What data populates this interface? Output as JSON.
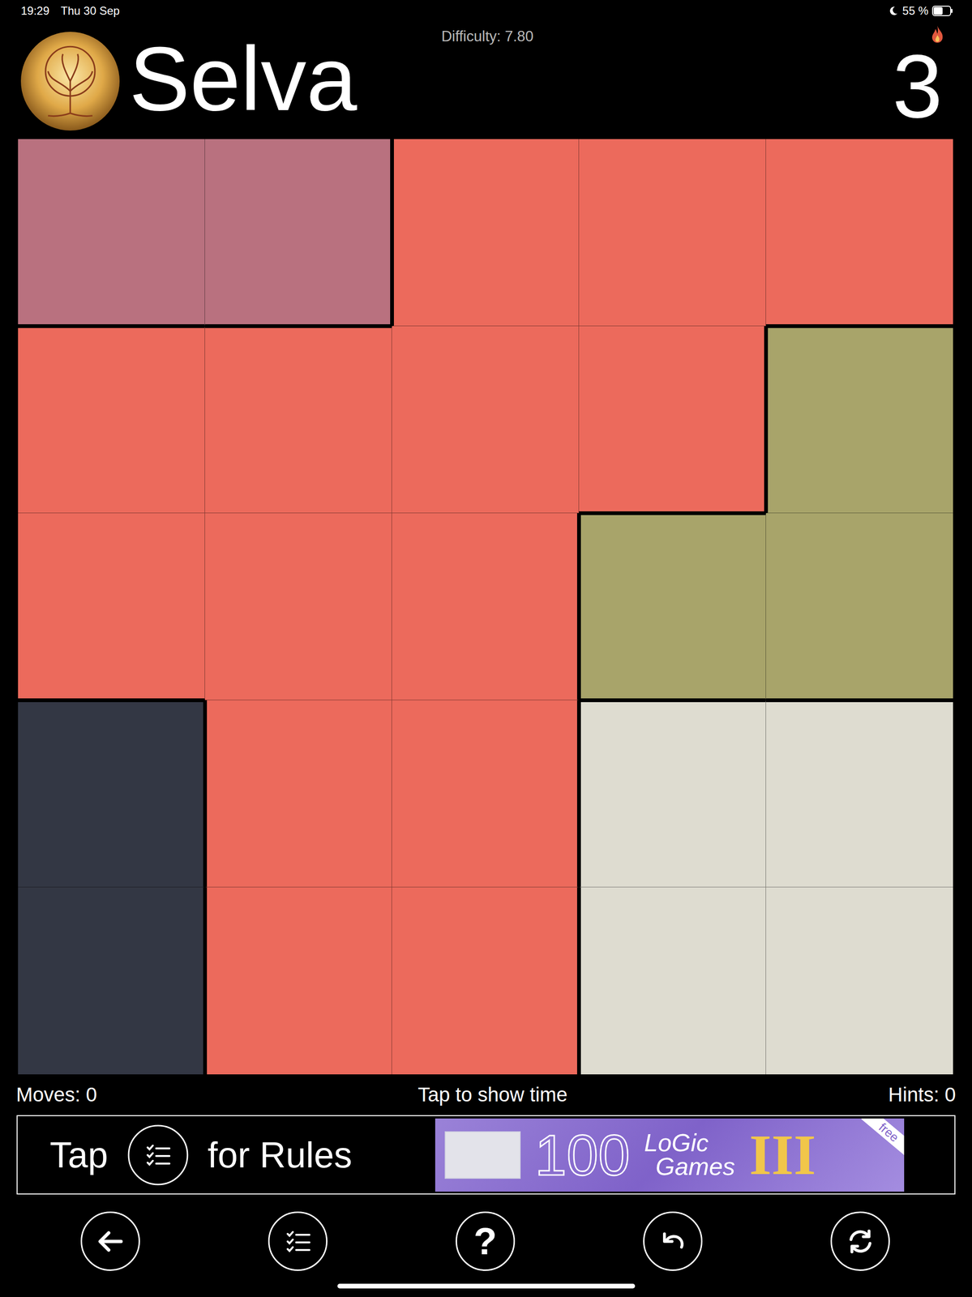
{
  "status_bar": {
    "time": "19:29",
    "date": "Thu 30 Sep",
    "battery": "55 %",
    "battery_level": 0.55
  },
  "header": {
    "difficulty": "Difficulty: 7.80",
    "title": "Selva",
    "level": "3"
  },
  "grid": {
    "rows": [
      [
        {
          "color": "#B9717F"
        },
        {
          "color": "#B9717F"
        },
        {
          "color": "#EC6A5C"
        },
        {
          "color": "#EC6A5C"
        },
        {
          "color": "#EC6A5C"
        }
      ],
      [
        {
          "color": "#EC6A5C"
        },
        {
          "color": "#EC6A5C"
        },
        {
          "color": "#EC6A5C"
        },
        {
          "color": "#EC6A5C"
        },
        {
          "color": "#A8A46A"
        }
      ],
      [
        {
          "color": "#EC6A5C"
        },
        {
          "color": "#EC6A5C"
        },
        {
          "color": "#EC6A5C"
        },
        {
          "color": "#A8A46A"
        },
        {
          "color": "#A8A46A"
        }
      ],
      [
        {
          "color": "#333744"
        },
        {
          "color": "#EC6A5C"
        },
        {
          "color": "#EC6A5C"
        },
        {
          "color": "#DEDCD0"
        },
        {
          "color": "#DEDCD0"
        }
      ],
      [
        {
          "color": "#333744"
        },
        {
          "color": "#EC6A5C"
        },
        {
          "color": "#EC6A5C"
        },
        {
          "color": "#DEDCD0"
        },
        {
          "color": "#DEDCD0"
        }
      ]
    ]
  },
  "counters": {
    "moves": "Moves: 0",
    "timer": "Tap to show time",
    "hints": "Hints: 0"
  },
  "rules": {
    "before": "Tap",
    "after": "for Rules"
  },
  "ad": {
    "number": "100",
    "line1": "LoGic",
    "line2": "Games",
    "numeral": "III",
    "ribbon": "free"
  },
  "toolbar": {
    "help": "?"
  }
}
